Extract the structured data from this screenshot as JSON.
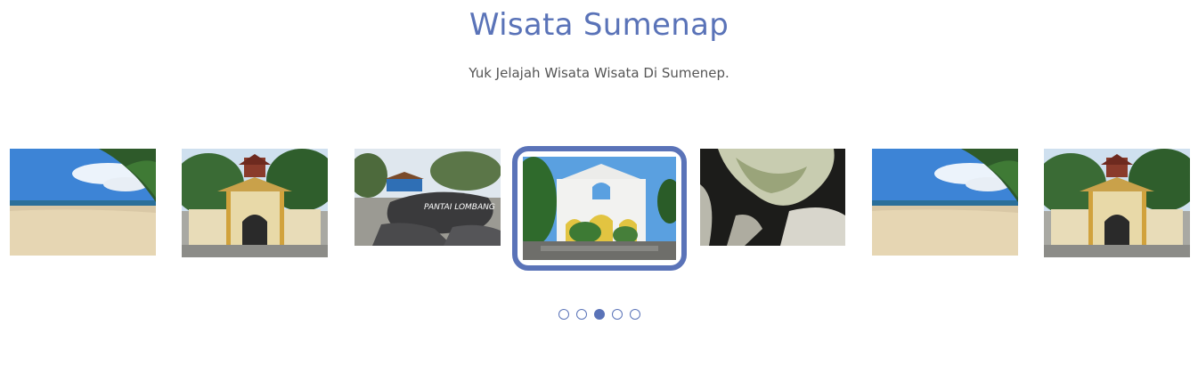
{
  "section": {
    "title": "Wisata Sumenap",
    "subtitle": "Yuk Jelajah Wisata Wisata Di Sumenep."
  },
  "carousel": {
    "slide_count": 5,
    "active_index": 2,
    "slides": [
      {
        "subject": "beach"
      },
      {
        "subject": "gate"
      },
      {
        "subject": "rock-sign",
        "sign_text": "PANTAI LOMBANG"
      },
      {
        "subject": "palace-gate"
      },
      {
        "subject": "cave"
      },
      {
        "subject": "beach"
      },
      {
        "subject": "gate"
      }
    ]
  },
  "colors": {
    "accent": "#5a73b8",
    "text": "#555555"
  }
}
